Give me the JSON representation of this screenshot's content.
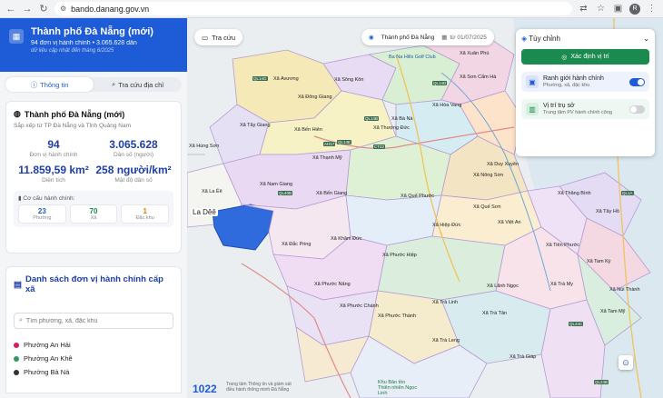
{
  "browser": {
    "url": "bando.danang.gov.vn",
    "avatar_letter": "R"
  },
  "hero": {
    "title": "Thành phố Đà Nẵng (mới)",
    "subtitle": "94 đơn vị hành chính • 3.065.628 dân",
    "updated": "dữ liệu cập nhật đến tháng 6/2025"
  },
  "tabs": [
    {
      "label": "Thông tin",
      "active": true
    },
    {
      "label": "Tra cứu địa chỉ",
      "active": false
    }
  ],
  "info_card": {
    "title": "Thành phố Đà Nẵng (mới)",
    "description": "Sắp xếp từ TP Đà Nẵng và Tỉnh Quảng Nam",
    "stats": [
      {
        "value": "94",
        "label": "Đơn vị hành chính"
      },
      {
        "value": "3.065.628",
        "label": "Dân số (người)"
      },
      {
        "value": "11.859,59 km²",
        "label": "Diện tích"
      },
      {
        "value": "258 người/km²",
        "label": "Mật độ dân số"
      }
    ],
    "structure_title": "Cơ cấu hành chính:",
    "structure": [
      {
        "count": "23",
        "kind": "Phường",
        "color": "#1e5bd7"
      },
      {
        "count": "70",
        "kind": "Xã",
        "color": "#1b8a4f"
      },
      {
        "count": "1",
        "kind": "Đặc khu",
        "color": "#e07b00"
      }
    ]
  },
  "list_card": {
    "title": "Danh sách đơn vị hành chính cấp xã",
    "search_placeholder": "Tìm phường, xã, đặc khu",
    "wards": [
      {
        "name": "Phường An Hải",
        "color": "#d81b60"
      },
      {
        "name": "Phường An Khê",
        "color": "#2e9d5b"
      },
      {
        "name": "Phường Bà Nà",
        "color": "#333333"
      }
    ]
  },
  "map": {
    "search_button": "Tra cứu",
    "location": "Thành phố Đà Nẵng",
    "date": "từ 01/07/2025",
    "settings_title": "Tùy chỉnh",
    "locate_button": "Xác định vị trí",
    "options": [
      {
        "title": "Ranh giới hành chính",
        "desc": "Phường, xã, đặc khu",
        "on": true
      },
      {
        "title": "Vị trí trụ sở",
        "desc": "Trung tâm PV hành chính công",
        "on": false
      }
    ],
    "logo": "1022",
    "footer_note": [
      "Trang tâm Thông tin và giám sát",
      "điều hành thông minh Đà Nẵng"
    ],
    "region_labels": [
      "Xã Avương",
      "Xã Sông Kôn",
      "Xã Đông Giang",
      "Xã Tây Giang",
      "Xã Bến Hiên",
      "Xã Thượng Đức",
      "Xã Hùng Sơn",
      "Xã Thạnh Mỹ",
      "Xã Hòa Vang",
      "Xã Bà Nà",
      "Xã Nam Giang",
      "Xã Bến Giang",
      "Xã Quế Phước",
      "Xã La Êê",
      "La Dêê",
      "Xã Đắc Pring",
      "Xã Khâm Đức",
      "Xã Phước Hiệp",
      "Xã Phước Năng",
      "Xã Phước Chánh",
      "Xã Phước Thành",
      "Xã Trà Linh",
      "Xã Trà Tân",
      "Xã Trà Leng",
      "Xã Trà Giáp",
      "Xã Nông Sơn",
      "Xã Quế Sơn",
      "Xã Hiệp Đức",
      "Xã Việt An",
      "Xã Thăng Bình",
      "Xã Tam Kỳ",
      "Xã Núi Thành",
      "Xã Tiên Phước",
      "Xã Duy Xuyên",
      "Xã Trà My",
      "Xã Tam Mỹ",
      "Xã Lãnh Ngọc",
      "Xã Sơn Cẩm Hà",
      "Xã Xuân Phú",
      "Xã Tây Hồ",
      "Ba Na Hills Golf Club",
      "Khu Bảo tồn Thiên nhiên Ngọc Linh"
    ],
    "roads": [
      "QL14G",
      "QL14B",
      "QL14D",
      "QL14E",
      "QL40B",
      "AH17",
      "CT22",
      "QL24C",
      "QL1A",
      "QL24B"
    ]
  }
}
